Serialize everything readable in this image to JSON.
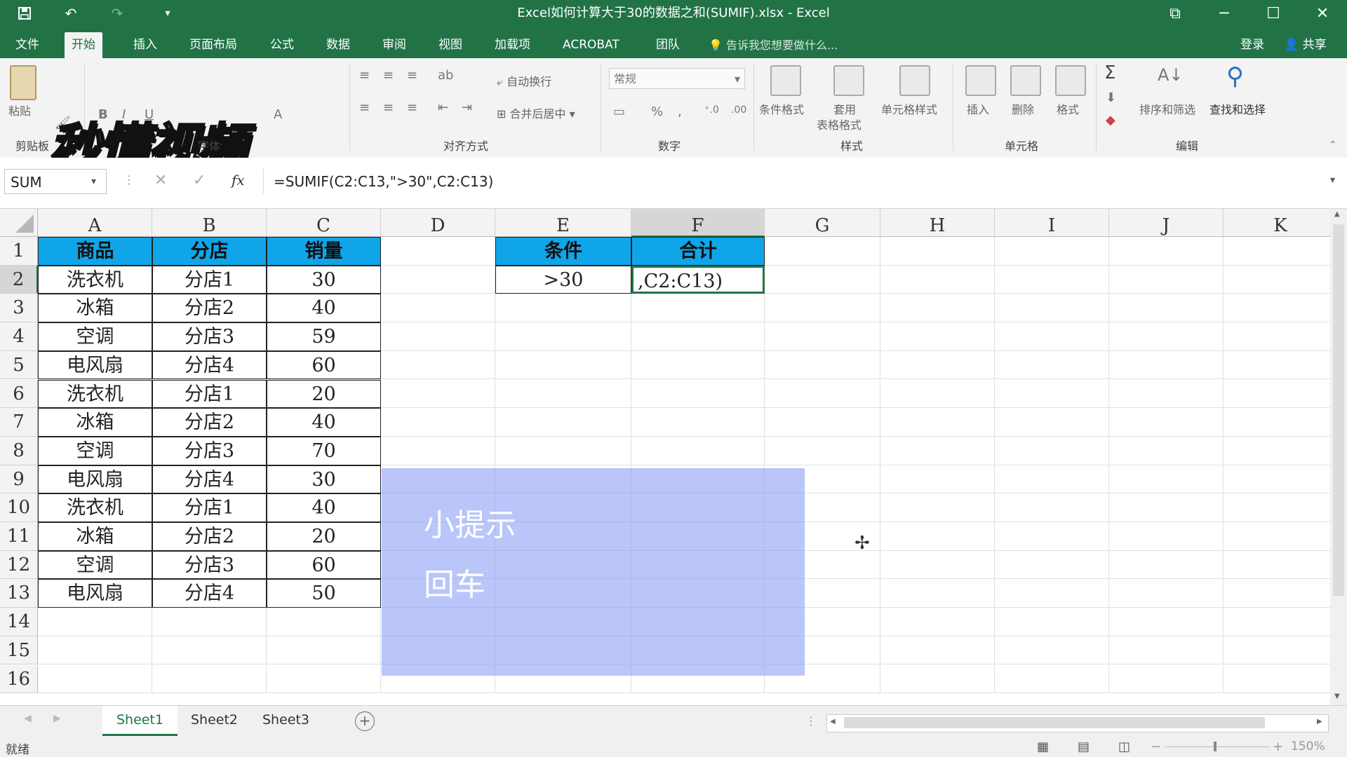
{
  "title_bar": {
    "document_title": "Excel如何计算大于30的数据之和(SUMIF).xlsx - Excel",
    "save_icon": "save-icon",
    "undo_icon": "undo-icon",
    "redo_icon": "redo-icon",
    "customize_icon": "customize-qat-icon",
    "window_controls": [
      "ribbon-display-icon",
      "minimize-icon",
      "maximize-icon",
      "close-icon"
    ]
  },
  "menu": {
    "tabs": [
      "文件",
      "开始",
      "插入",
      "页面布局",
      "公式",
      "数据",
      "审阅",
      "视图",
      "加载项",
      "ACROBAT",
      "团队"
    ],
    "active_tab": "开始",
    "tell_me": "告诉我您想要做什么...",
    "login": "登录",
    "share": "共享"
  },
  "ribbon": {
    "groups": {
      "clipboard": "剪贴板",
      "font": "字体",
      "alignment": "对齐方式",
      "number": "数字",
      "styles": "样式",
      "cells": "单元格",
      "editing": "编辑"
    },
    "paste": "粘贴",
    "wrap_text": "自动换行",
    "merge_center": "合并后居中",
    "number_format": "常规",
    "conditional_format": "条件格式",
    "table_format_line1": "套用",
    "table_format_line2": "表格格式",
    "cell_styles": "单元格样式",
    "insert": "插入",
    "delete": "删除",
    "format": "格式",
    "sort_filter": "排序和筛选",
    "find_select": "查找和选择",
    "watermark": "秒懂视频"
  },
  "formula_bar": {
    "name_box": "SUM",
    "formula": "=SUMIF(C2:C13,\">30\",C2:C13)"
  },
  "sheet": {
    "columns": [
      "A",
      "B",
      "C",
      "D",
      "E",
      "F",
      "G",
      "H",
      "I",
      "J",
      "K"
    ],
    "rows": [
      "1",
      "2",
      "3",
      "4",
      "5",
      "6",
      "7",
      "8",
      "9",
      "10",
      "11",
      "12",
      "13",
      "14",
      "15",
      "16"
    ],
    "table_header": [
      "商品",
      "分店",
      "销量"
    ],
    "table_rows": [
      [
        "洗衣机",
        "分店1",
        "30"
      ],
      [
        "冰箱",
        "分店2",
        "40"
      ],
      [
        "空调",
        "分店3",
        "59"
      ],
      [
        "电风扇",
        "分店4",
        "60"
      ],
      [
        "洗衣机",
        "分店1",
        "20"
      ],
      [
        "冰箱",
        "分店2",
        "40"
      ],
      [
        "空调",
        "分店3",
        "70"
      ],
      [
        "电风扇",
        "分店4",
        "30"
      ],
      [
        "洗衣机",
        "分店1",
        "40"
      ],
      [
        "冰箱",
        "分店2",
        "20"
      ],
      [
        "空调",
        "分店3",
        "60"
      ],
      [
        "电风扇",
        "分店4",
        "50"
      ]
    ],
    "criteria_header": "条件",
    "sum_header": "合计",
    "criteria_value": ">30",
    "editing_cell_text": ",C2:C13)"
  },
  "tip": {
    "title": "小提示",
    "body": "回车"
  },
  "sheet_tabs": [
    "Sheet1",
    "Sheet2",
    "Sheet3"
  ],
  "active_sheet": "Sheet1",
  "status": {
    "ready": "就绪",
    "zoom": "150%"
  },
  "colors": {
    "excel_green": "#217346",
    "header_fill": "#10a5e8",
    "tip_overlay": "#8296f5"
  }
}
